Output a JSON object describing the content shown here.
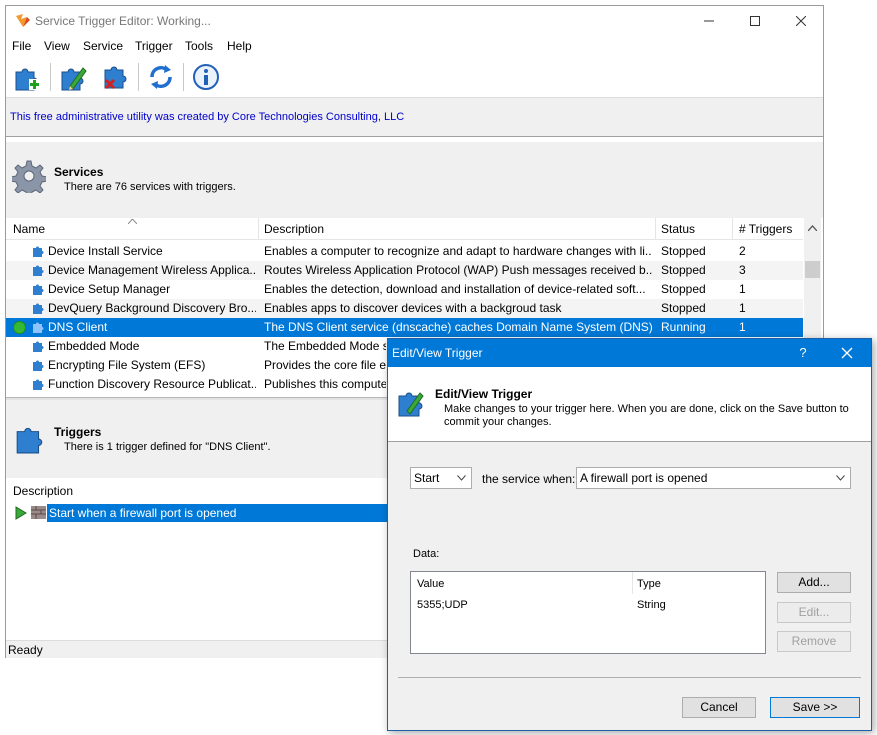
{
  "window": {
    "title": "Service Trigger Editor: Working..."
  },
  "menu": [
    "File",
    "View",
    "Service",
    "Trigger",
    "Tools",
    "Help"
  ],
  "toolbar": {
    "buttons": [
      "add-trigger-icon",
      "edit-trigger-icon",
      "delete-trigger-icon",
      "refresh-icon",
      "info-icon"
    ]
  },
  "banner": {
    "text": "This free administrative utility was created by Core Technologies Consulting, LLC"
  },
  "services": {
    "title": "Services",
    "subtitle": "There are 76 services with triggers.",
    "columns": [
      "Name",
      "Description",
      "Status",
      "# Triggers"
    ],
    "rows": [
      {
        "name": "Device Install Service",
        "description": "Enables a computer to recognize and adapt to hardware changes with li...",
        "status": "Stopped",
        "triggers": "2"
      },
      {
        "name": "Device Management Wireless Applica...",
        "description": "Routes Wireless Application Protocol (WAP) Push messages received b...",
        "status": "Stopped",
        "triggers": "3"
      },
      {
        "name": "Device Setup Manager",
        "description": "Enables the detection, download and installation of device-related soft...",
        "status": "Stopped",
        "triggers": "1"
      },
      {
        "name": "DevQuery Background Discovery Bro...",
        "description": "Enables apps to discover devices with a backgroud task",
        "status": "Stopped",
        "triggers": "1"
      },
      {
        "name": "DNS Client",
        "description": "The DNS Client service (dnscache) caches Domain Name System (DNS)...",
        "status": "Running",
        "triggers": "1"
      },
      {
        "name": "Embedded Mode",
        "description": "The Embedded Mode s",
        "status": "",
        "triggers": ""
      },
      {
        "name": "Encrypting File System (EFS)",
        "description": "Provides the core file en",
        "status": "",
        "triggers": ""
      },
      {
        "name": "Function Discovery Resource Publicat...",
        "description": "Publishes this compute",
        "status": "",
        "triggers": ""
      }
    ],
    "selected_index": 4
  },
  "triggers": {
    "title": "Triggers",
    "subtitle": "There is 1 trigger defined for \"DNS Client\".",
    "column": "Description",
    "rows": [
      "Start when a firewall port is opened"
    ]
  },
  "status_bar": {
    "text": "Ready"
  },
  "dialog": {
    "title": "Edit/View Trigger",
    "help": "?",
    "header_title": "Edit/View Trigger",
    "header_desc": "Make changes to your trigger here. When you are done, click on the Save button to commit your changes.",
    "action_value": "Start",
    "middle_label": "the service when:",
    "event_value": "A firewall port is opened",
    "data_label": "Data:",
    "data_columns": [
      "Value",
      "Type"
    ],
    "data_rows": [
      {
        "value": "5355;UDP",
        "type": "String"
      }
    ],
    "add_label": "Add...",
    "edit_label": "Edit...",
    "remove_label": "Remove",
    "cancel_label": "Cancel",
    "save_label": "Save >>"
  },
  "colors": {
    "selection": "#0078d7",
    "link_blue": "#0000cc",
    "running_green": "#2fb52f"
  }
}
